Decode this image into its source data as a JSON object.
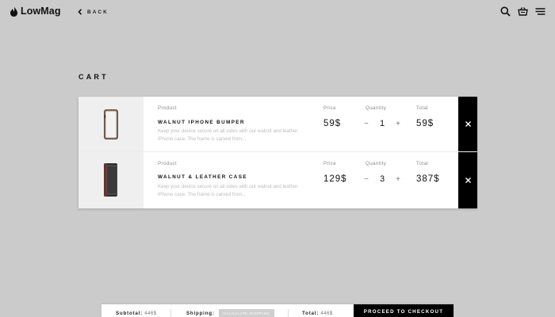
{
  "header": {
    "logo_text": "LowMag",
    "back_label": "BACK"
  },
  "cart": {
    "title": "CART",
    "column_labels": {
      "product": "Product",
      "price": "Price",
      "quantity": "Quantity",
      "total": "Total"
    },
    "items": [
      {
        "name": "WALNUT IPHONE BUMPER",
        "description": "Keep your device secure on all sides with our walnut and leather iPhone case. The frame is carved from...",
        "price": "59$",
        "quantity": "1",
        "total": "59$",
        "image": "iphone-bumper"
      },
      {
        "name": "WALNUT & LEATHER CASE",
        "description": "Keep your device secure on all sides with our walnut and leather iPhone case. The frame is carved from...",
        "price": "129$",
        "quantity": "3",
        "total": "387$",
        "image": "leather-case"
      }
    ],
    "qty_minus": "−",
    "qty_plus": "+"
  },
  "footer": {
    "subtotal_label": "Subtotal:",
    "subtotal_value": "446$",
    "shipping_label": "Shipping:",
    "calculate_shipping": "CALCULATE SHIPPING",
    "total_label": "Total:",
    "total_value": "446$",
    "checkout_label": "PROCEED TO CHECKOUT"
  },
  "icons": {
    "logo": "flame-logo-icon",
    "back": "chevron-left-icon",
    "search": "search-icon",
    "basket": "basket-icon",
    "menu": "hamburger-menu-icon",
    "remove": "close-icon"
  },
  "colors": {
    "background": "#cbcbcb",
    "accent": "#000000"
  }
}
